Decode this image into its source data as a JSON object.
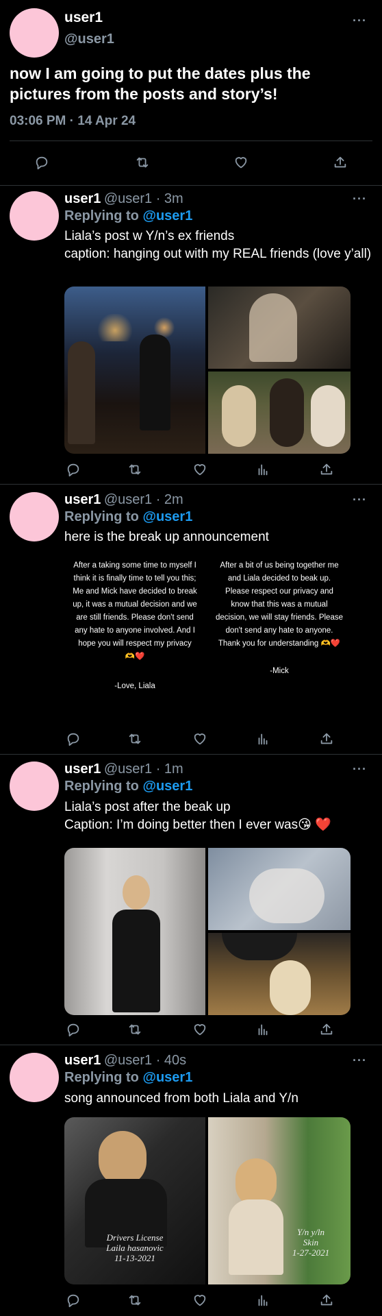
{
  "main": {
    "name": "user1",
    "handle": "@user1",
    "text": "now I am going to put the dates plus the pictures from the posts and story’s!",
    "timestamp": "03:06 PM · 14 Apr 24"
  },
  "replies": [
    {
      "name": "user1",
      "meta": "@user1 · 3m",
      "replying_prefix": "Replying to ",
      "replying_handle": "@user1",
      "text": "Liala’s post w Y/n’s ex friends\ncaption: hanging out with my REAL friends (love y’all)"
    },
    {
      "name": "user1",
      "meta": "@user1 · 2m",
      "replying_prefix": "Replying to ",
      "replying_handle": "@user1",
      "text": "here is the break up announcement",
      "announcement_left": "After a taking some time to myself I\nthink it is finally time to tell you this;\nMe and Mick have decided to break\nup, it was a mutual decision and we\nare still friends. Please don't send\nany hate to anyone involved. And I\nhope you will respect my privacy\n🫶❤️",
      "announcement_left_sign": "-Love, Liala",
      "announcement_right": "After a bit of us being together me\nand Liala decided to beak up.\nPlease respect our privacy and\nknow that this was a mutual\ndecision, we will stay friends. Please\ndon't send any hate to anyone.\nThank you for understanding 🫶❤️",
      "announcement_right_sign": "-Mick"
    },
    {
      "name": "user1",
      "meta": "@user1 · 1m",
      "replying_prefix": "Replying to ",
      "replying_handle": "@user1",
      "text": "Liala’s post after the beak up\nCaption: I’m doing better then I ever was😘 ❤️"
    },
    {
      "name": "user1",
      "meta": "@user1 · 40s",
      "replying_prefix": "Replying to ",
      "replying_handle": "@user1",
      "text": "song announced from both Liala and Y/n",
      "album_left": "Drivers License\nLaila hasanovic\n11-13-2021",
      "album_right": "Y/n y/ln\nSkin\n1-27-2021"
    }
  ],
  "icons": {
    "reply": "reply-icon",
    "retweet": "retweet-icon",
    "like": "heart-icon",
    "views": "views-icon",
    "share": "share-icon",
    "more": "more-icon"
  },
  "colors": {
    "avatar": "#fcc6d8",
    "link": "#1d9bf0",
    "muted": "#8b98a5"
  }
}
